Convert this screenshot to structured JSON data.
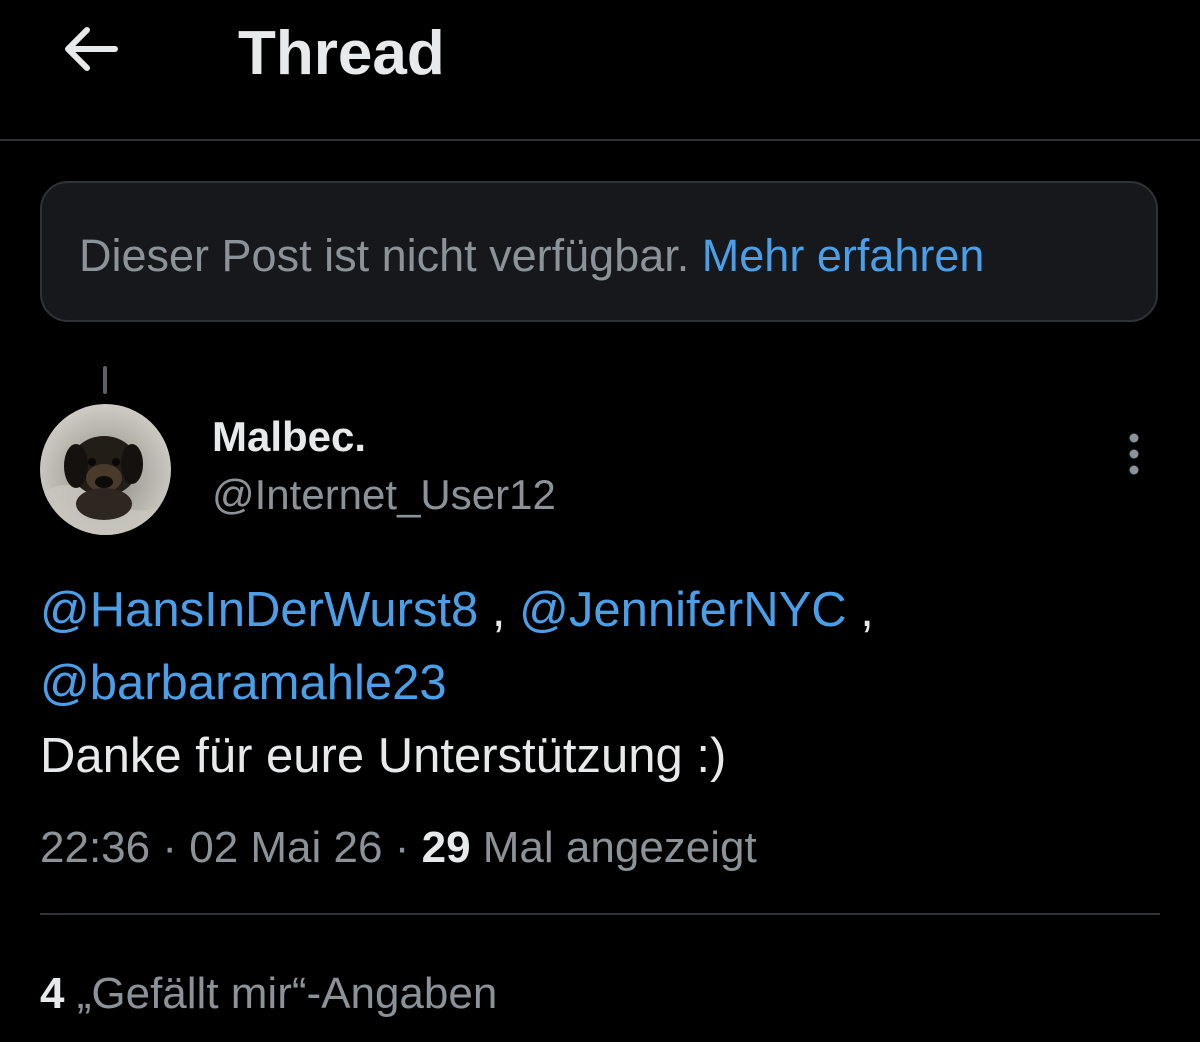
{
  "header": {
    "title": "Thread",
    "back_icon": "arrow-left-icon"
  },
  "unavailable": {
    "message": "Dieser Post ist nicht verfügbar.",
    "link": "Mehr erfahren"
  },
  "post": {
    "display_name": "Malbec.",
    "handle": "@Internet_User12",
    "mentions": [
      "@HansInDerWurst8",
      "@JenniferNYC",
      "@barbaramahle23"
    ],
    "separator": ",",
    "text": "Danke für eure Unterstützung :)",
    "time": "22:36",
    "date": "02 Mai 26",
    "dot": "·",
    "views_count": "29",
    "views_label": "Mal angezeigt",
    "more_icon": "more-vertical-icon"
  },
  "engagement": {
    "likes_count": "4",
    "likes_label": "„Gefällt mir“-Angaben"
  },
  "colors": {
    "background": "#000000",
    "text": "#e7e9ea",
    "secondary_text": "#8b9298",
    "link": "#4a9fe8",
    "border": "#2f3336",
    "box_background": "#16181c"
  }
}
